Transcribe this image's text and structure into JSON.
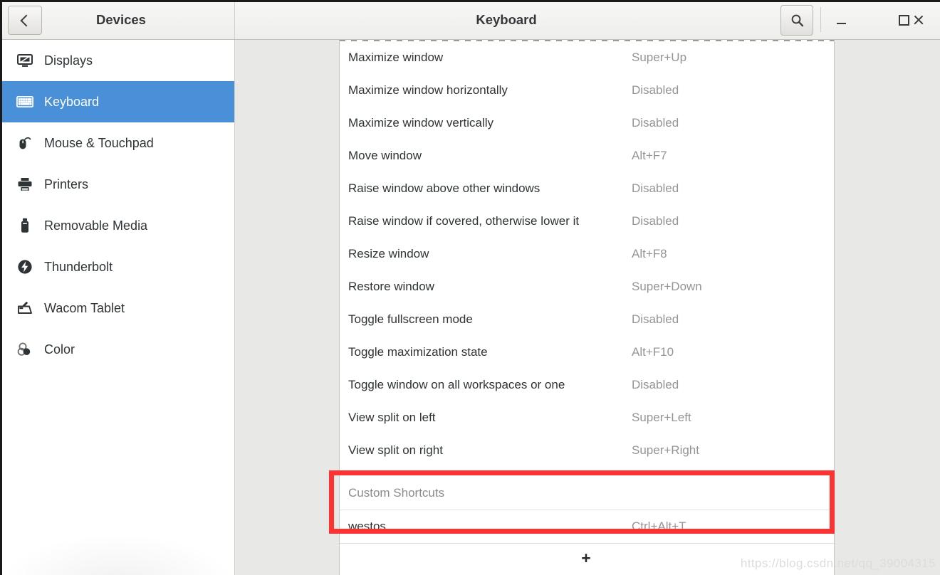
{
  "titlebar": {
    "back_icon": "chevron-left-icon",
    "panel_title": "Devices",
    "window_title": "Keyboard",
    "search_icon": "search-icon",
    "minimize_icon": "minimize-icon",
    "maximize_icon": "maximize-icon",
    "close_icon": "close-icon"
  },
  "sidebar": {
    "items": [
      {
        "label": "Displays",
        "icon": "display-icon",
        "selected": false
      },
      {
        "label": "Keyboard",
        "icon": "keyboard-icon",
        "selected": true
      },
      {
        "label": "Mouse & Touchpad",
        "icon": "mouse-icon",
        "selected": false
      },
      {
        "label": "Printers",
        "icon": "printer-icon",
        "selected": false
      },
      {
        "label": "Removable Media",
        "icon": "usb-drive-icon",
        "selected": false
      },
      {
        "label": "Thunderbolt",
        "icon": "thunderbolt-icon",
        "selected": false
      },
      {
        "label": "Wacom Tablet",
        "icon": "wacom-tablet-icon",
        "selected": false
      },
      {
        "label": "Color",
        "icon": "color-icon",
        "selected": false
      }
    ]
  },
  "shortcuts": {
    "rows": [
      {
        "name": "Maximize window",
        "value": "Super+Up"
      },
      {
        "name": "Maximize window horizontally",
        "value": "Disabled"
      },
      {
        "name": "Maximize window vertically",
        "value": "Disabled"
      },
      {
        "name": "Move window",
        "value": "Alt+F7"
      },
      {
        "name": "Raise window above other windows",
        "value": "Disabled"
      },
      {
        "name": "Raise window if covered, otherwise lower it",
        "value": "Disabled"
      },
      {
        "name": "Resize window",
        "value": "Alt+F8"
      },
      {
        "name": "Restore window",
        "value": "Super+Down"
      },
      {
        "name": "Toggle fullscreen mode",
        "value": "Disabled"
      },
      {
        "name": "Toggle maximization state",
        "value": "Alt+F10"
      },
      {
        "name": "Toggle window on all workspaces or one",
        "value": "Disabled"
      },
      {
        "name": "View split on left",
        "value": "Super+Left"
      },
      {
        "name": "View split on right",
        "value": "Super+Right"
      }
    ],
    "custom_section_label": "Custom Shortcuts",
    "custom_rows": [
      {
        "name": "westos",
        "value": "Ctrl+Alt+T"
      }
    ],
    "add_label": "+"
  },
  "annotation": {
    "highlight_color": "#fc3333"
  },
  "watermark": {
    "text": "https://blog.csdn.net/qq_39004315"
  }
}
